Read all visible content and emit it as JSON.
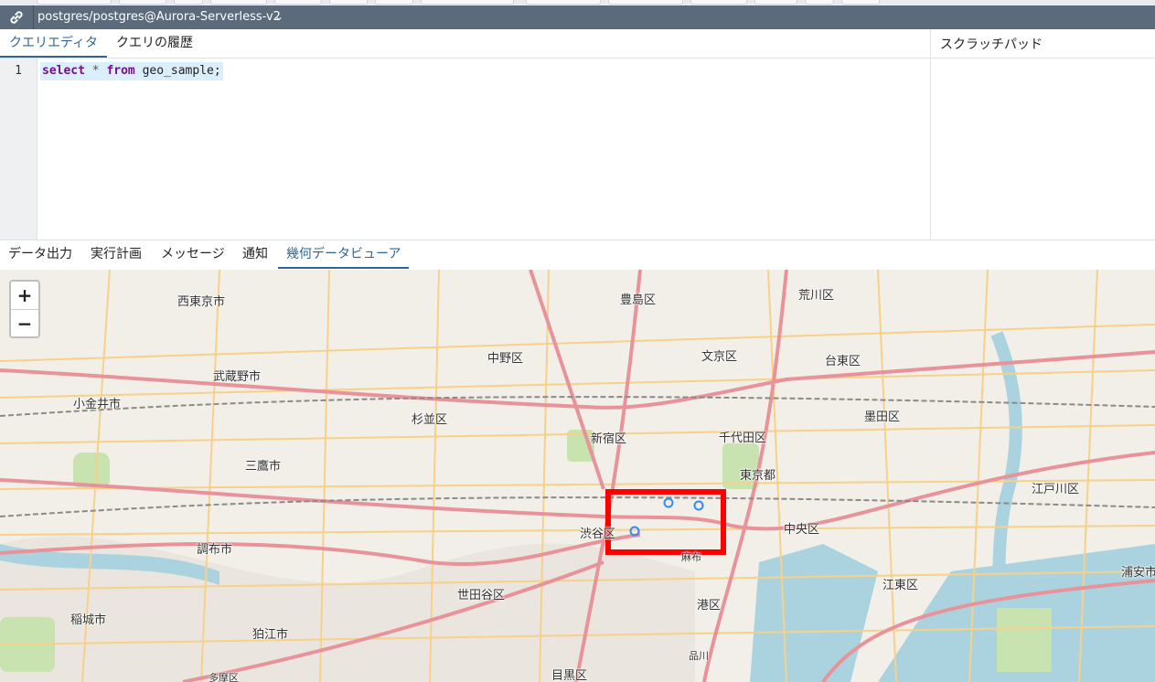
{
  "connection": {
    "label": "postgres/postgres@Aurora-Serverless-v2"
  },
  "editor_tabs": [
    {
      "label": "クエリエディタ"
    },
    {
      "label": "クエリの履歴"
    }
  ],
  "scratch_pad": {
    "title": "スクラッチパッド"
  },
  "editor": {
    "line_number": "1",
    "tokens": {
      "kw1": "select",
      "star": "*",
      "kw2": "from",
      "rest": "geo_sample;"
    }
  },
  "result_tabs": [
    {
      "label": "データ出力"
    },
    {
      "label": "実行計画"
    },
    {
      "label": "メッセージ"
    },
    {
      "label": "通知"
    },
    {
      "label": "幾何データビューア"
    }
  ],
  "map": {
    "zoom_in": "+",
    "zoom_out": "−",
    "labels": [
      "西東京市",
      "豊島区",
      "荒川区",
      "中野区",
      "文京区",
      "台東区",
      "武蔵野市",
      "小金井市",
      "杉並区",
      "新宿区",
      "千代田区",
      "墨田区",
      "三鷹市",
      "東京都",
      "江戸川区",
      "渋谷区",
      "中央区",
      "調布市",
      "江東区",
      "浦安市",
      "世田谷区",
      "港区",
      "稲城市",
      "狛江市",
      "目黒区",
      "品川",
      "多摩区",
      "麻布"
    ],
    "colors": {
      "highlight": "#ff0000",
      "marker": "#3388ff",
      "road_major": "#e8929a",
      "road_minor": "#f7d089",
      "water": "#aad3df",
      "park": "#c8e2b0"
    }
  }
}
